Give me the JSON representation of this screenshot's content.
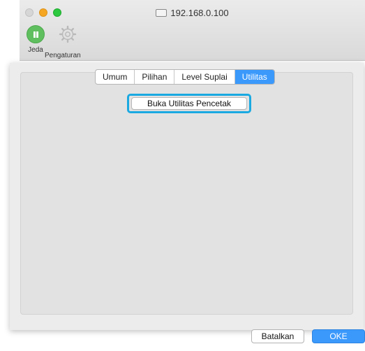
{
  "window": {
    "title": "192.168.0.100",
    "toolbar": {
      "pause_label": "Jeda",
      "settings_label": "Pengaturan"
    }
  },
  "dialog": {
    "tabs": [
      {
        "label": "Umum",
        "active": false
      },
      {
        "label": "Pilihan",
        "active": false
      },
      {
        "label": "Level Suplai",
        "active": false
      },
      {
        "label": "Utilitas",
        "active": true
      }
    ],
    "open_utility_label": "Buka Utilitas Pencetak",
    "cancel_label": "Batalkan",
    "ok_label": "OKE"
  },
  "colors": {
    "accent": "#3b99fc",
    "highlight": "#1ba9e1",
    "pause_green": "#5fbf5f"
  },
  "icons": {
    "pause": "pause-icon",
    "settings": "gear-icon",
    "printer": "printer-icon"
  }
}
